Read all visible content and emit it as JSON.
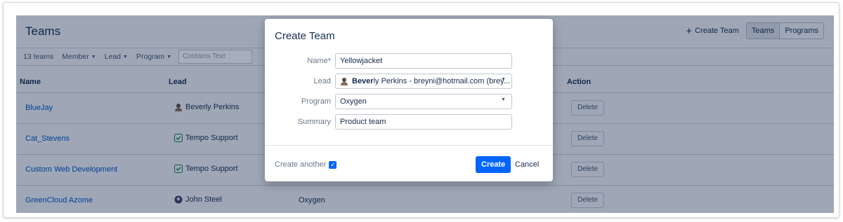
{
  "header": {
    "title": "Teams",
    "create_team_label": "Create Team",
    "view_tabs": [
      {
        "label": "Teams",
        "active": true
      },
      {
        "label": "Programs",
        "active": false
      }
    ]
  },
  "filters": {
    "count_label": "13 teams",
    "member_label": "Member",
    "lead_label": "Lead",
    "program_label": "Program",
    "text_placeholder": "Contains Text"
  },
  "table": {
    "columns": {
      "name": "Name",
      "lead": "Lead",
      "action": "Action"
    },
    "rows": [
      {
        "name": "BlueJay",
        "lead": "Beverly Perkins",
        "lead_icon": "user-avatar-icon",
        "program": "",
        "action": "Delete"
      },
      {
        "name": "Cat_Stevens",
        "lead": "Tempo Support",
        "lead_icon": "checkbox-avatar-icon",
        "program": "",
        "action": "Delete"
      },
      {
        "name": "Custom Web Development",
        "lead": "Tempo Support",
        "lead_icon": "checkbox-avatar-icon",
        "program": "",
        "action": "Delete"
      },
      {
        "name": "GreenCloud Azome",
        "lead": "John Steel",
        "lead_icon": "user-avatar-icon",
        "program": "Oxygen",
        "action": "Delete"
      }
    ]
  },
  "dialog": {
    "title": "Create Team",
    "fields": {
      "name": {
        "label": "Name*",
        "value": "Yellowjacket"
      },
      "lead": {
        "label": "Lead",
        "value_bold": "Bever",
        "value_rest": "ly Perkins - breyni@hotmail.com (brey..."
      },
      "program": {
        "label": "Program",
        "value": "Oxygen"
      },
      "summary": {
        "label": "Summary",
        "value": "Product team"
      }
    },
    "create_another_label": "Create another",
    "create_another_checked": true,
    "create_button": "Create",
    "cancel_button": "Cancel"
  },
  "colors": {
    "accent": "#0065ff",
    "link": "#0052cc",
    "overlay": "rgba(9,30,66,0.36)"
  }
}
